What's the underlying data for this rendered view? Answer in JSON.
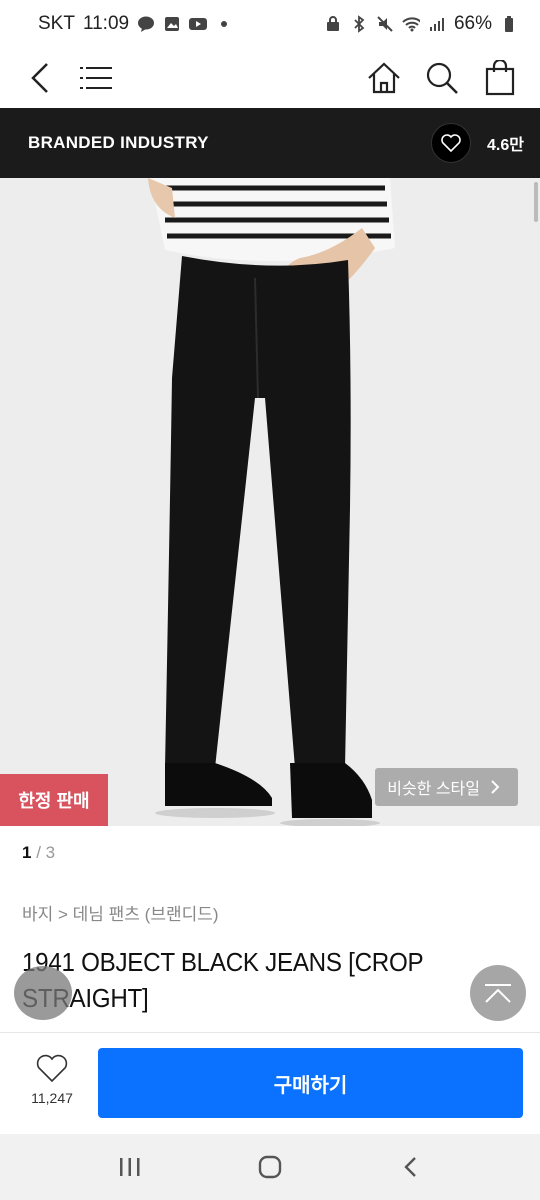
{
  "status_bar": {
    "carrier": "SKT",
    "time": "11:09",
    "battery": "66%"
  },
  "nav": {
    "icons": [
      "back-icon",
      "menu-icon",
      "home-icon",
      "search-icon",
      "shopping-bag-icon"
    ]
  },
  "brand": {
    "name": "BRANDED INDUSTRY",
    "likes": "4.6만"
  },
  "product": {
    "badge": "한정 판매",
    "similar_style": "비슷한 스타일",
    "pager": {
      "current": "1",
      "separator": "/",
      "total": "3"
    },
    "breadcrumb": "바지 > 데님 팬츠 (브랜디드)",
    "title_line1": "1941 OBJECT BLACK JEANS [CROP",
    "title_line2": "STRAIGHT]"
  },
  "actions": {
    "wish_count": "11,247",
    "buy_label": "구매하기"
  },
  "colors": {
    "buy": "#0a72ff",
    "badge": "#d9535f",
    "brand_bar": "#1b1b1b"
  }
}
